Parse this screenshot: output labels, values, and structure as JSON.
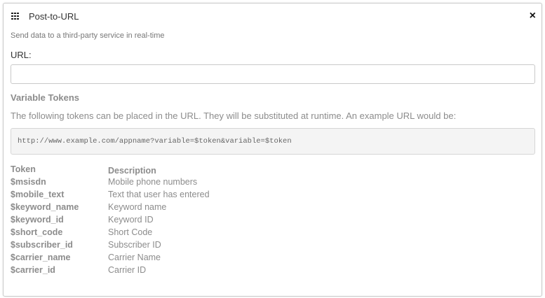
{
  "dialog": {
    "title": "Post-to-URL",
    "icon": "grid-icon",
    "close_label": "×",
    "subtitle": "Send data to a third-party service in real-time"
  },
  "url_field": {
    "label": "URL:",
    "value": "",
    "placeholder": ""
  },
  "variable_tokens": {
    "heading": "Variable Tokens",
    "description": "The following tokens can be placed in the URL. They will be substituted at runtime. An example URL would be:",
    "example_url": "http://www.example.com/appname?variable=$token&variable=$token",
    "columns": {
      "token": "Token",
      "description": "Description"
    },
    "rows": [
      {
        "token": "$msisdn",
        "description": "Mobile phone numbers"
      },
      {
        "token": "$mobile_text",
        "description": "Text that user has entered"
      },
      {
        "token": "$keyword_name",
        "description": "Keyword name"
      },
      {
        "token": "$keyword_id",
        "description": "Keyword ID"
      },
      {
        "token": "$short_code",
        "description": "Short Code"
      },
      {
        "token": "$subscriber_id",
        "description": "Subscriber ID"
      },
      {
        "token": "$carrier_name",
        "description": "Carrier Name"
      },
      {
        "token": "$carrier_id",
        "description": "Carrier ID"
      }
    ]
  }
}
